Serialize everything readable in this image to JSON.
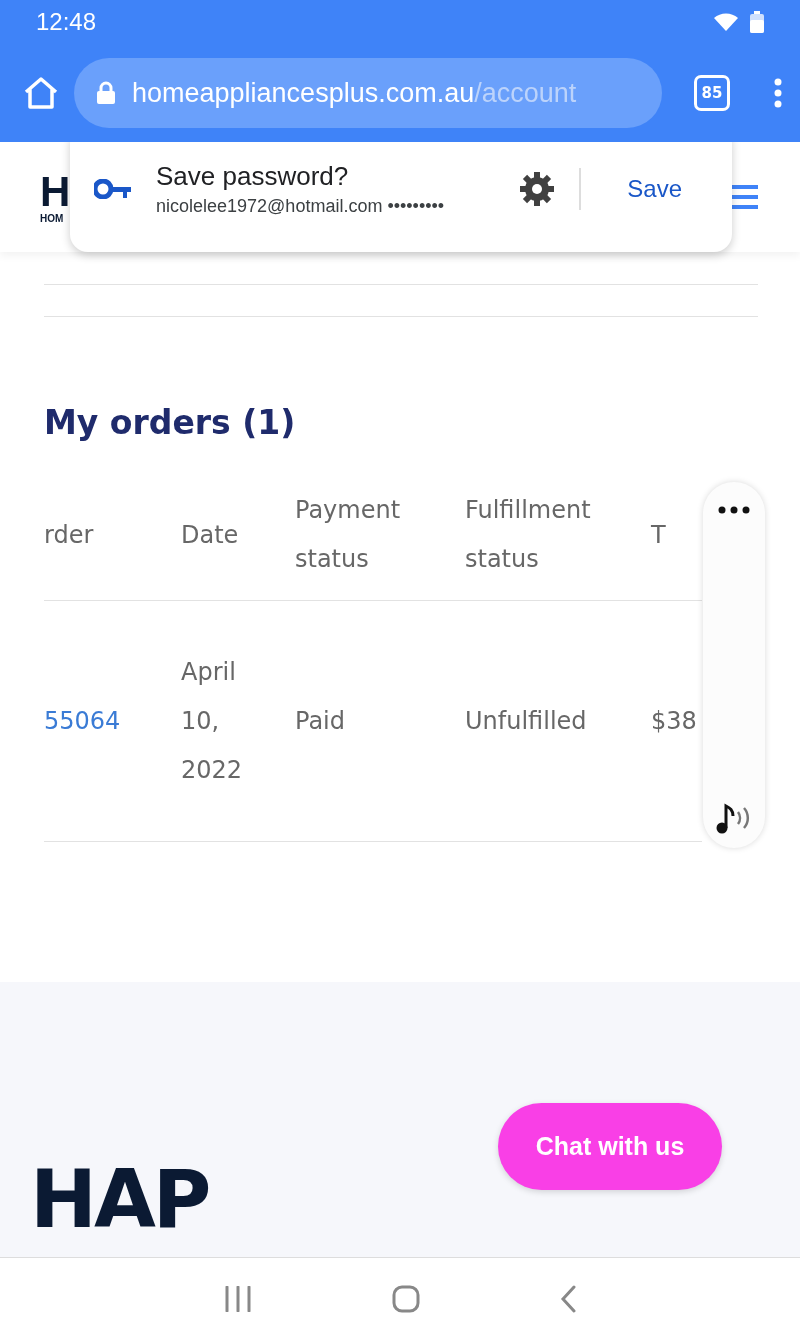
{
  "status_bar": {
    "time": "12:48"
  },
  "browser": {
    "url_host": "homeappliancesplus.com.au",
    "url_path": "/account",
    "tab_count": "85"
  },
  "password_prompt": {
    "title": "Save password?",
    "account": "nicolelee1972@hotmail.com",
    "masked_password": "•••••••••",
    "save_button": "Save"
  },
  "header": {
    "logo": "H",
    "logo_subtitle": "HOM"
  },
  "orders": {
    "title": "My orders (1)",
    "columns": [
      "rder",
      "Date",
      "Payment status",
      "Fulfillment status",
      "T"
    ],
    "rows": [
      {
        "cells": [
          {
            "text": "55064",
            "kind": "link"
          },
          {
            "text": "April 10, 2022",
            "kind": "text"
          },
          {
            "text": "Paid",
            "kind": "text"
          },
          {
            "text": "Unfulfilled",
            "kind": "text"
          },
          {
            "text": "$38",
            "kind": "text"
          }
        ]
      }
    ]
  },
  "chat_button": "Chat with us",
  "footer": {
    "logo": "HAP"
  }
}
